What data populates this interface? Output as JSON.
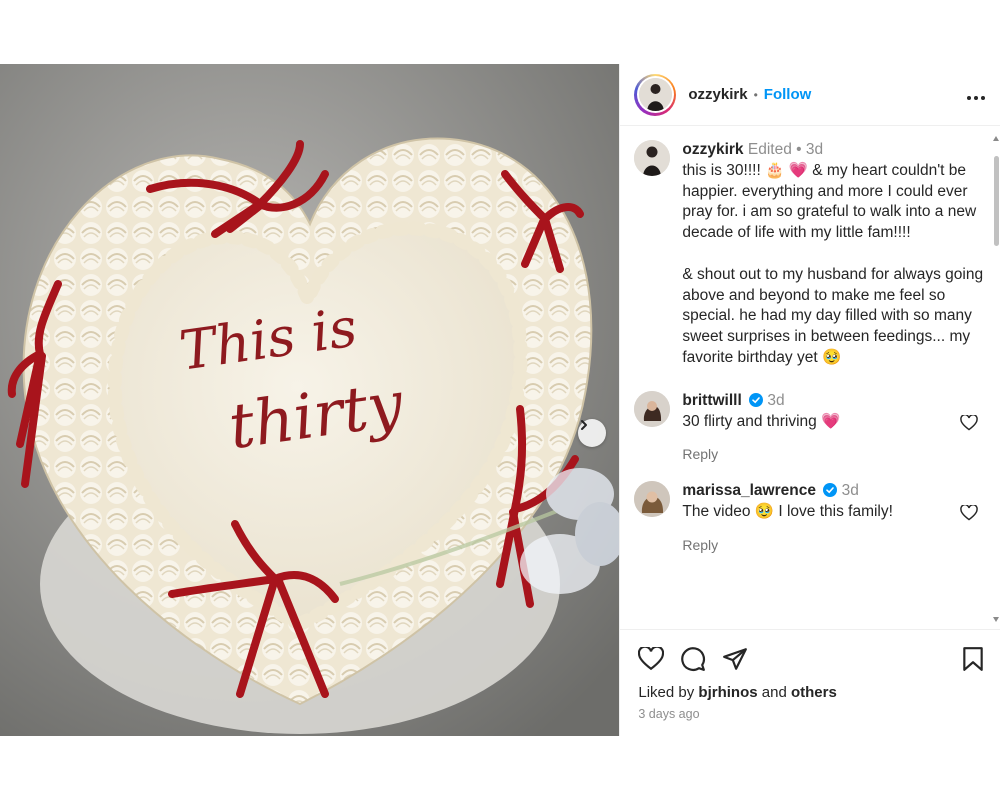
{
  "header": {
    "username": "ozzykirk",
    "separator": "•",
    "follow_label": "Follow",
    "more_icon": "more-horizontal-icon"
  },
  "caption": {
    "username": "ozzykirk",
    "edited": "Edited",
    "separator": "•",
    "time": "3d",
    "text": "this is 30!!!! 🎂 💗 & my heart couldn't be happier. everything and more I could ever pray for. i am so grateful to walk into a new decade of life with my little fam!!!!\n\n& shout out to my husband for always going above and beyond to make me feel so special. he had my day filled with so many sweet surprises in between feedings... my favorite birthday yet 🥹"
  },
  "comments": [
    {
      "username": "brittwilll",
      "verified": true,
      "time": "3d",
      "text": "30 flirty and thriving 💗",
      "reply_label": "Reply"
    },
    {
      "username": "marissa_lawrence",
      "verified": true,
      "time": "3d",
      "text": "The video 🥹 I love this family!",
      "reply_label": "Reply"
    }
  ],
  "actions": {
    "icons": [
      "heart-icon",
      "comment-icon",
      "share-icon",
      "bookmark-icon"
    ],
    "liked_by_prefix": "Liked by",
    "liked_by_user": "bjrhinos",
    "liked_by_and": "and",
    "liked_by_others": "others",
    "time_ago": "3 days ago"
  },
  "media": {
    "cake_text_line1": "This is",
    "cake_text_line2": "thirty",
    "next_icon": "chevron-right-icon"
  },
  "colors": {
    "accent_blue": "#0095f6",
    "heart_pink": "#e91e63",
    "cake_red": "#8e1a1f",
    "ribbon_red": "#a8141c",
    "frosting": "#f4efe2"
  }
}
